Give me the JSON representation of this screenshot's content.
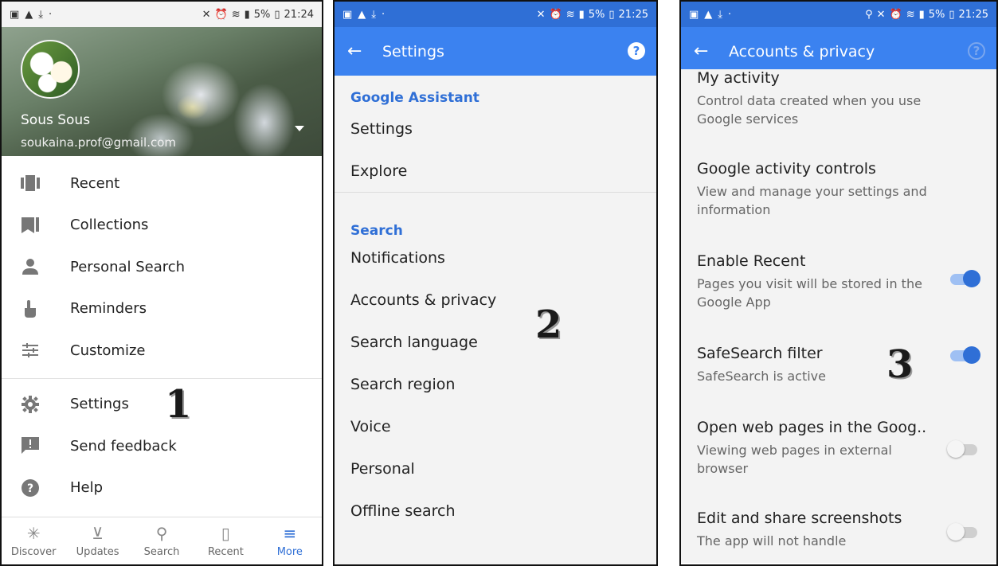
{
  "status": {
    "time1": "21:24",
    "time2": "21:25",
    "time3": "21:25",
    "battery": "5%"
  },
  "panel1": {
    "profile": {
      "name": "Sous Sous",
      "email": "soukaina.prof@gmail.com"
    },
    "menu": [
      {
        "label": "Recent",
        "icon": "recent-icon"
      },
      {
        "label": "Collections",
        "icon": "bookmark-icon"
      },
      {
        "label": "Personal Search",
        "icon": "person-icon"
      },
      {
        "label": "Reminders",
        "icon": "reminder-hand-icon"
      },
      {
        "label": "Customize",
        "icon": "sliders-icon"
      }
    ],
    "menu2": [
      {
        "label": "Settings",
        "icon": "gear-icon"
      },
      {
        "label": "Send feedback",
        "icon": "feedback-icon"
      },
      {
        "label": "Help",
        "icon": "help-icon"
      }
    ],
    "nav": [
      {
        "label": "Discover",
        "glyph": "✳"
      },
      {
        "label": "Updates",
        "glyph": "⊻"
      },
      {
        "label": "Search",
        "glyph": "⚲"
      },
      {
        "label": "Recent",
        "glyph": "▯"
      },
      {
        "label": "More",
        "glyph": "≡"
      }
    ],
    "step": "1"
  },
  "panel2": {
    "title": "Settings",
    "section1": "Google Assistant",
    "items1": [
      "Settings",
      "Explore"
    ],
    "section2": "Search",
    "items2": [
      "Notifications",
      "Accounts & privacy",
      "Search language",
      "Search region",
      "Voice",
      "Personal",
      "Offline search"
    ],
    "step": "2"
  },
  "panel3": {
    "title": "Accounts & privacy",
    "rows": [
      {
        "title": "My activity",
        "sub": "Control data created when you use Google services",
        "toggle": null
      },
      {
        "title": "Google activity controls",
        "sub": "View and manage your settings and information",
        "toggle": null
      },
      {
        "title": "Enable Recent",
        "sub": "Pages you visit will be stored in the Google App",
        "toggle": "on"
      },
      {
        "title": "SafeSearch filter",
        "sub": "SafeSearch is active",
        "toggle": "on"
      },
      {
        "title": "Open web pages in the Goog..",
        "sub": "Viewing web pages in external browser",
        "toggle": "off"
      },
      {
        "title": "Edit and share screenshots",
        "sub": "The app will not handle",
        "toggle": "off"
      }
    ],
    "step": "3"
  },
  "colors": {
    "accent": "#3b82f0",
    "section": "#2f6fd6"
  }
}
